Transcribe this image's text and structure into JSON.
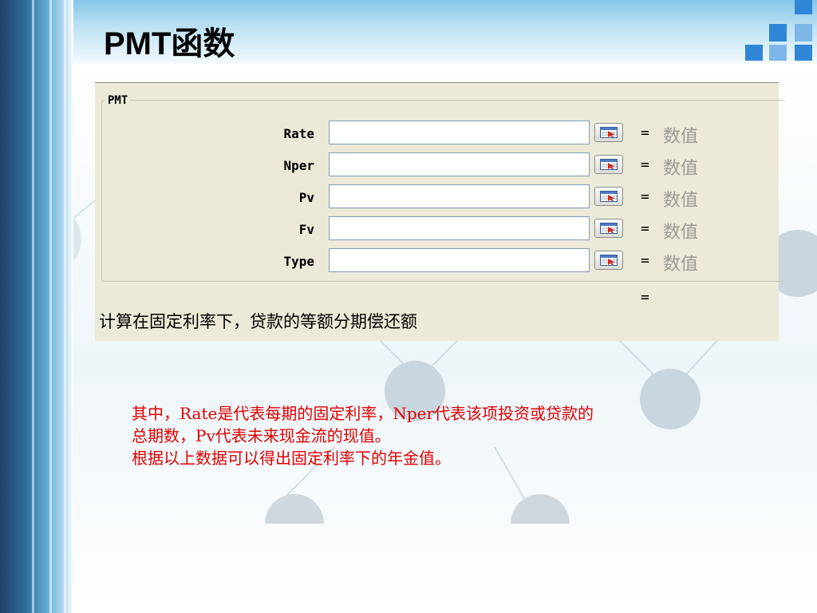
{
  "slide": {
    "title": "PMT函数"
  },
  "dialog": {
    "group_label": "PMT",
    "args": [
      {
        "name": "Rate",
        "equals": "=",
        "value": "数值"
      },
      {
        "name": "Nper",
        "equals": "=",
        "value": "数值"
      },
      {
        "name": "Pv",
        "equals": "=",
        "value": "数值"
      },
      {
        "name": "Fv",
        "equals": "=",
        "value": "数值"
      },
      {
        "name": "Type",
        "equals": "=",
        "value": "数值"
      }
    ],
    "result_equals": "=",
    "description": "计算在固定利率下，贷款的等额分期偿还额"
  },
  "notes": {
    "line1": "其中，Rate是代表每期的固定利率，Nper代表该项投资或贷款的",
    "line2": "总期数，Pv代表未来现金流的现值。",
    "line3": "根据以上数据可以得出固定利率下的年金值。"
  },
  "colors": {
    "notes_text": "#e00000",
    "placeholder": "#9a9a9a",
    "dialog_bg": "#ece9d8"
  }
}
